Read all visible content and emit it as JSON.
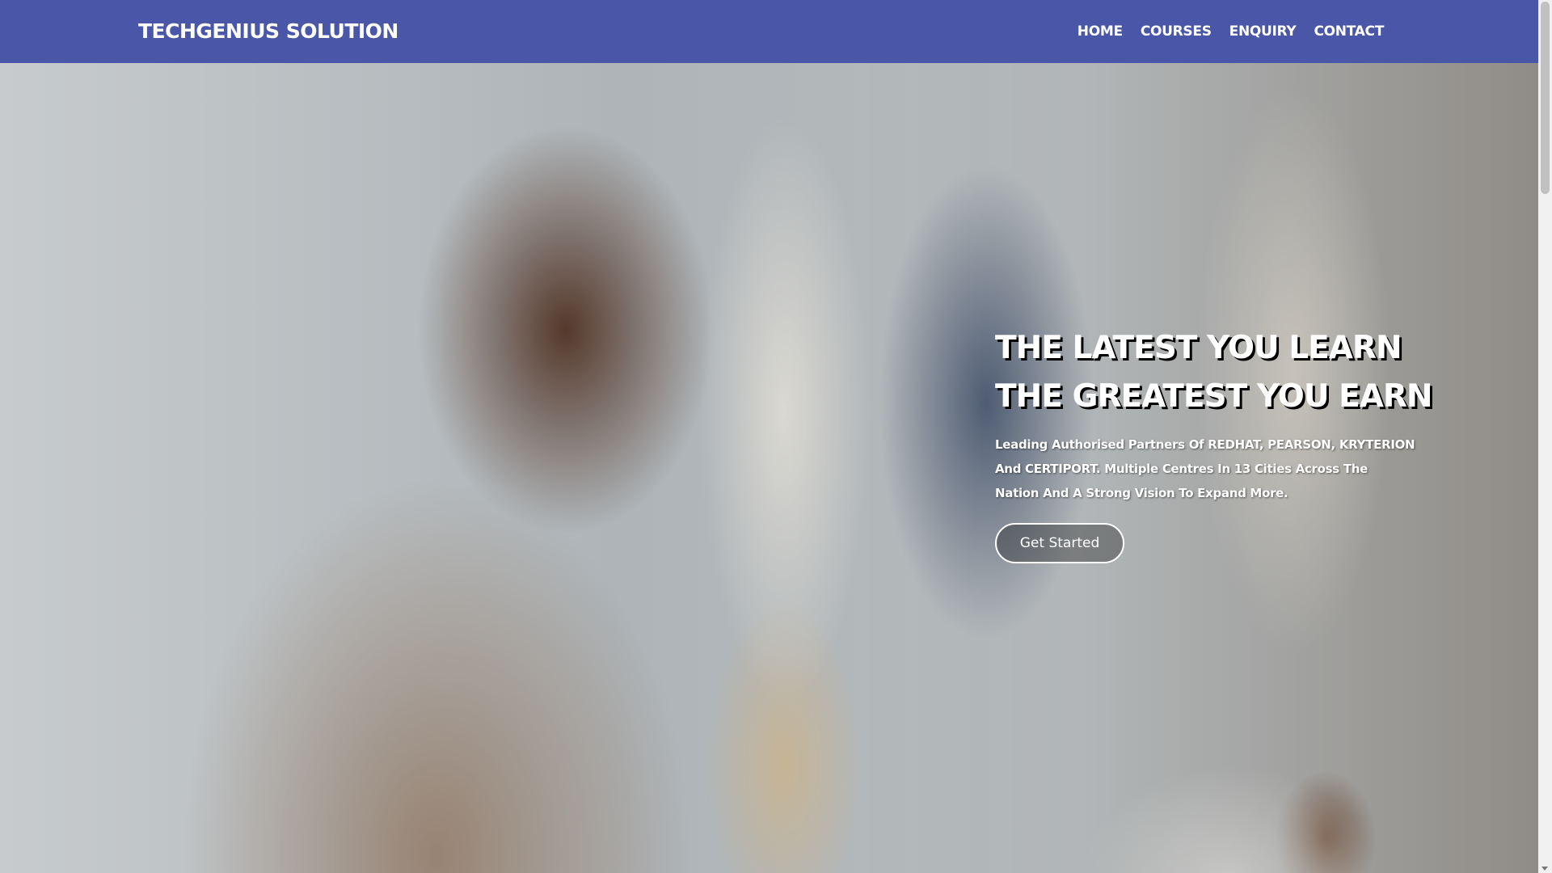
{
  "colors": {
    "navbar_bg": "#4a57a8",
    "text": "#ffffff"
  },
  "navbar": {
    "brand": "TECHGENIUS SOLUTION",
    "links": [
      {
        "label": "HOME"
      },
      {
        "label": "COURSES"
      },
      {
        "label": "ENQUIRY"
      },
      {
        "label": "CONTACT"
      }
    ]
  },
  "hero": {
    "title_line1": "THE LATEST YOU LEARN",
    "title_line2": "THE GREATEST YOU EARN",
    "subtitle": "Leading Authorised Partners Of REDHAT, PEARSON, KRYTERION And CERTIPORT. Multiple Centres In 13 Cities Across The Nation And A Strong Vision To Expand More.",
    "cta_label": "Get Started"
  }
}
